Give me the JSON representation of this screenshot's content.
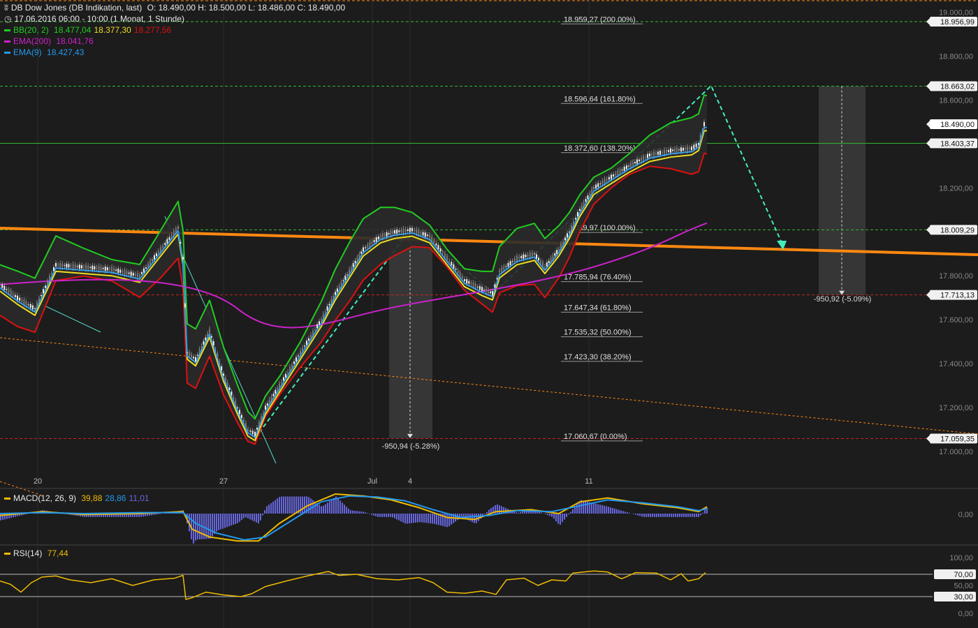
{
  "header": {
    "icon": "candlestick-icon",
    "title": "DB Dow Jones (DB Indikation, last)",
    "ohlc": "O: 18.490,00  H: 18.500,00  L: 18.486,00  C: 18.490,00",
    "clock_icon": "clock-icon",
    "timespan": "17.06.2016 06:00 - 10:00 (1 Monat, 1 Stunde)"
  },
  "legend": {
    "bb": {
      "label": "BB(20, 2)",
      "v1": "18.477,04",
      "v2": "18.377,30",
      "v3": "18.277,56"
    },
    "ema200": {
      "label": "EMA(200)",
      "v": "18.041,76"
    },
    "ema9": {
      "label": "EMA(9)",
      "v": "18.427,43"
    },
    "macd": {
      "label": "MACD(12, 26, 9)",
      "v1": "39,88",
      "v2": "28,86",
      "v3": "11,01"
    },
    "rsi": {
      "label": "RSI(14)",
      "v": "77,44"
    }
  },
  "colors": {
    "background": "#1c1c1c",
    "price": "#e8e8e8",
    "bb_upper": "#22cc22",
    "bb_mid": "#eedd22",
    "bb_lower": "#dd1111",
    "ema200": "#cc22cc",
    "ema9": "#2299ee",
    "trend": "#ff8811",
    "projection": "#44eebb",
    "level_green": "#33bb33",
    "level_red": "#cc2222",
    "macd_hist": "#6666dd",
    "rsi": "#eebb00"
  },
  "chart_data": {
    "type": "candlestick",
    "x_ticks": [
      "20",
      "27",
      "Jul",
      "4",
      "11"
    ],
    "y_ticks": [
      "19.000,00",
      "18.800,00",
      "18.600,00",
      "18.200,00",
      "17.800,00",
      "17.600,00",
      "17.400,00",
      "17.200,00",
      "17.000,00"
    ],
    "ylim": [
      16.98,
      19.03
    ],
    "macd_ticks": [
      "0,00"
    ],
    "rsi_ticks": [
      "100,00",
      "50,00",
      "0,00"
    ],
    "rsi_levels": [
      "70,00",
      "30,00"
    ],
    "price_markers": [
      {
        "label": "18.956,99",
        "value": 18.957,
        "style": "green"
      },
      {
        "label": "18.663,02",
        "value": 18.663,
        "style": "green"
      },
      {
        "label": "18.490,00",
        "value": 18.49,
        "style": "current"
      },
      {
        "label": "18.403,37",
        "value": 18.403,
        "style": "green-solid"
      },
      {
        "label": "18.009,29",
        "value": 18.009,
        "style": "green"
      },
      {
        "label": "17.713,13",
        "value": 17.713,
        "style": "red"
      },
      {
        "label": "17.059,35",
        "value": 17.059,
        "style": "red"
      }
    ],
    "fib_levels": [
      {
        "label": "18.959,27 (200.00%)",
        "value": 18.959
      },
      {
        "label": "18.596,64 (161.80%)",
        "value": 18.597
      },
      {
        "label": "18.372,60 (138.20%)",
        "value": 18.373
      },
      {
        "label": "18.009,97 (100.00%)",
        "value": 18.01
      },
      {
        "label": "17.785,94 (76.40%)",
        "value": 17.786
      },
      {
        "label": "17.647,34 (61.80%)",
        "value": 17.647
      },
      {
        "label": "17.535,32 (50.00%)",
        "value": 17.535
      },
      {
        "label": "17.423,30 (38.20%)",
        "value": 17.423
      },
      {
        "label": "17.060,67 (0.00%)",
        "value": 17.061
      }
    ],
    "measurements": [
      {
        "label": "-950,94 (-5.28%)",
        "from": 18.01,
        "to": 17.06
      },
      {
        "label": "-950,92 (-5.09%)",
        "from": 18.663,
        "to": 17.713
      }
    ],
    "close_path": [
      [
        0,
        17.76
      ],
      [
        25,
        17.7
      ],
      [
        50,
        17.65
      ],
      [
        80,
        17.85
      ],
      [
        120,
        17.84
      ],
      [
        160,
        17.83
      ],
      [
        200,
        17.8
      ],
      [
        230,
        17.92
      ],
      [
        255,
        18.02
      ],
      [
        262,
        17.88
      ],
      [
        268,
        17.45
      ],
      [
        280,
        17.42
      ],
      [
        300,
        17.55
      ],
      [
        320,
        17.35
      ],
      [
        340,
        17.2
      ],
      [
        355,
        17.1
      ],
      [
        365,
        17.08
      ],
      [
        380,
        17.2
      ],
      [
        400,
        17.3
      ],
      [
        430,
        17.45
      ],
      [
        460,
        17.6
      ],
      [
        480,
        17.72
      ],
      [
        500,
        17.82
      ],
      [
        520,
        17.92
      ],
      [
        545,
        17.98
      ],
      [
        565,
        18.0
      ],
      [
        590,
        18.01
      ],
      [
        615,
        17.98
      ],
      [
        640,
        17.88
      ],
      [
        665,
        17.78
      ],
      [
        690,
        17.74
      ],
      [
        705,
        17.72
      ],
      [
        715,
        17.82
      ],
      [
        740,
        17.88
      ],
      [
        765,
        17.9
      ],
      [
        780,
        17.84
      ],
      [
        800,
        17.92
      ],
      [
        815,
        18.0
      ],
      [
        830,
        18.1
      ],
      [
        850,
        18.2
      ],
      [
        875,
        18.25
      ],
      [
        900,
        18.3
      ],
      [
        930,
        18.35
      ],
      [
        960,
        18.37
      ],
      [
        990,
        18.38
      ],
      [
        1000,
        18.4
      ],
      [
        1008,
        18.49
      ],
      [
        1012,
        18.49
      ]
    ],
    "macd_path": [
      [
        0,
        -0.1
      ],
      [
        60,
        0.1
      ],
      [
        120,
        -0.05
      ],
      [
        200,
        0.0
      ],
      [
        262,
        0.1
      ],
      [
        275,
        -0.8
      ],
      [
        300,
        -1.2
      ],
      [
        340,
        -1.4
      ],
      [
        370,
        -1.4
      ],
      [
        400,
        -0.5
      ],
      [
        440,
        0.4
      ],
      [
        480,
        1.0
      ],
      [
        520,
        0.9
      ],
      [
        560,
        0.7
      ],
      [
        600,
        0.3
      ],
      [
        640,
        -0.2
      ],
      [
        680,
        -0.3
      ],
      [
        710,
        0.1
      ],
      [
        760,
        0.2
      ],
      [
        800,
        0.0
      ],
      [
        830,
        0.6
      ],
      [
        870,
        0.8
      ],
      [
        920,
        0.5
      ],
      [
        970,
        0.3
      ],
      [
        1000,
        0.1
      ],
      [
        1012,
        0.35
      ]
    ],
    "macd_signal_path": [
      [
        0,
        0.0
      ],
      [
        60,
        0.05
      ],
      [
        120,
        0.0
      ],
      [
        200,
        0.05
      ],
      [
        262,
        0.05
      ],
      [
        280,
        -0.5
      ],
      [
        310,
        -1.0
      ],
      [
        350,
        -1.35
      ],
      [
        380,
        -1.2
      ],
      [
        420,
        -0.3
      ],
      [
        460,
        0.6
      ],
      [
        500,
        0.9
      ],
      [
        540,
        0.85
      ],
      [
        580,
        0.65
      ],
      [
        620,
        0.2
      ],
      [
        660,
        -0.2
      ],
      [
        700,
        -0.1
      ],
      [
        740,
        0.15
      ],
      [
        790,
        0.1
      ],
      [
        830,
        0.4
      ],
      [
        870,
        0.7
      ],
      [
        920,
        0.55
      ],
      [
        970,
        0.35
      ],
      [
        1000,
        0.15
      ],
      [
        1012,
        0.25
      ]
    ],
    "rsi_path": [
      [
        0,
        58
      ],
      [
        15,
        52
      ],
      [
        30,
        38
      ],
      [
        45,
        55
      ],
      [
        60,
        65
      ],
      [
        80,
        67
      ],
      [
        100,
        60
      ],
      [
        130,
        55
      ],
      [
        160,
        62
      ],
      [
        190,
        50
      ],
      [
        220,
        60
      ],
      [
        250,
        63
      ],
      [
        262,
        68
      ],
      [
        266,
        25
      ],
      [
        275,
        28
      ],
      [
        295,
        38
      ],
      [
        320,
        33
      ],
      [
        345,
        30
      ],
      [
        360,
        35
      ],
      [
        380,
        48
      ],
      [
        410,
        58
      ],
      [
        440,
        67
      ],
      [
        470,
        75
      ],
      [
        485,
        68
      ],
      [
        510,
        70
      ],
      [
        540,
        62
      ],
      [
        570,
        60
      ],
      [
        600,
        64
      ],
      [
        620,
        55
      ],
      [
        640,
        38
      ],
      [
        665,
        36
      ],
      [
        690,
        40
      ],
      [
        710,
        34
      ],
      [
        725,
        60
      ],
      [
        750,
        63
      ],
      [
        770,
        50
      ],
      [
        790,
        60
      ],
      [
        810,
        58
      ],
      [
        820,
        72
      ],
      [
        850,
        76
      ],
      [
        870,
        74
      ],
      [
        890,
        62
      ],
      [
        910,
        73
      ],
      [
        940,
        72
      ],
      [
        960,
        60
      ],
      [
        975,
        71
      ],
      [
        985,
        58
      ],
      [
        1000,
        62
      ],
      [
        1010,
        73
      ]
    ]
  }
}
